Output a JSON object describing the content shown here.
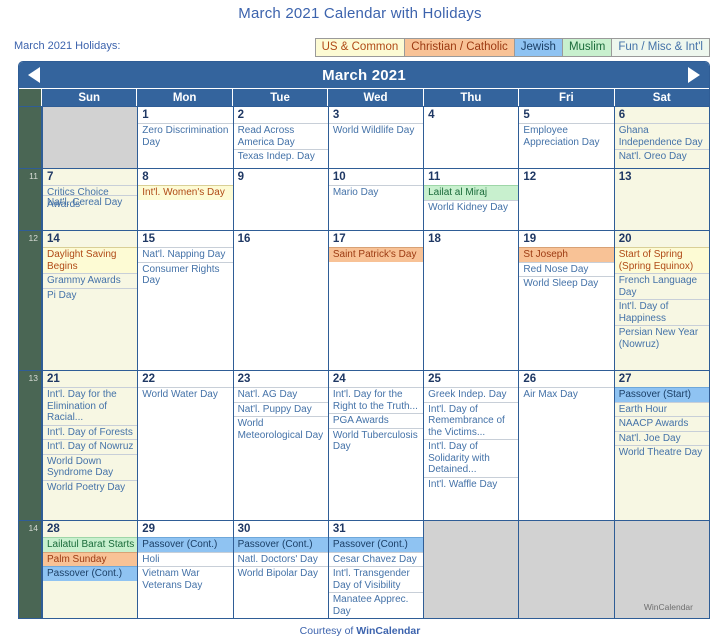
{
  "title": "March 2021 Calendar with Holidays",
  "legend": {
    "label": "March 2021 Holidays:",
    "chips": [
      {
        "label": "US & Common",
        "bg": "#fdfbd4",
        "fg": "#b04a16"
      },
      {
        "label": "Christian / Catholic",
        "bg": "#f8c296",
        "fg": "#9c3a12"
      },
      {
        "label": "Jewish",
        "bg": "#8fc3f2",
        "fg": "#1b3f66"
      },
      {
        "label": "Muslim",
        "bg": "#c8f0ce",
        "fg": "#1a6b3a"
      },
      {
        "label": "Fun / Misc & Int'l",
        "bg": "#eef7ee",
        "fg": "#4472a8"
      }
    ]
  },
  "nav": {
    "month_title": "March 2021",
    "prev_icon": "left-triangle-icon",
    "next_icon": "right-triangle-icon"
  },
  "weekdays": [
    "Sun",
    "Mon",
    "Tue",
    "Wed",
    "Thu",
    "Fri",
    "Sat"
  ],
  "weeks": [
    {
      "number": "",
      "days": [
        {
          "num": "",
          "blank": true,
          "weekend": false,
          "events": []
        },
        {
          "num": "1",
          "weekend": false,
          "events": [
            {
              "text": "Zero Discrimination Day",
              "cat": "plain"
            }
          ]
        },
        {
          "num": "2",
          "weekend": false,
          "events": [
            {
              "text": "Read Across America Day",
              "cat": "plain"
            },
            {
              "text": "Texas Indep. Day",
              "cat": "plain"
            }
          ]
        },
        {
          "num": "3",
          "weekend": false,
          "events": [
            {
              "text": "World Wildlife Day",
              "cat": "plain"
            }
          ]
        },
        {
          "num": "4",
          "weekend": false,
          "events": []
        },
        {
          "num": "5",
          "weekend": false,
          "events": [
            {
              "text": "Employee Appreciation Day",
              "cat": "plain"
            }
          ]
        },
        {
          "num": "6",
          "weekend": true,
          "events": [
            {
              "text": "Ghana Independence Day",
              "cat": "plain"
            },
            {
              "text": "Nat'l. Oreo Day",
              "cat": "plain"
            }
          ]
        }
      ]
    },
    {
      "number": "11",
      "days": [
        {
          "num": "7",
          "weekend": true,
          "events": [
            {
              "text": "Critics Choice Awards",
              "cat": "plain",
              "overlap_with": "Nat'l. Cereal Day"
            }
          ]
        },
        {
          "num": "8",
          "weekend": false,
          "events": [
            {
              "text": "Int'l. Women's Day",
              "cat": "us"
            }
          ]
        },
        {
          "num": "9",
          "weekend": false,
          "events": []
        },
        {
          "num": "10",
          "weekend": false,
          "events": [
            {
              "text": "Mario Day",
              "cat": "plain"
            }
          ]
        },
        {
          "num": "11",
          "weekend": false,
          "events": [
            {
              "text": "Lailat al Miraj",
              "cat": "muslim"
            },
            {
              "text": "World Kidney Day",
              "cat": "plain"
            }
          ]
        },
        {
          "num": "12",
          "weekend": false,
          "events": []
        },
        {
          "num": "13",
          "weekend": true,
          "events": []
        }
      ]
    },
    {
      "number": "12",
      "days": [
        {
          "num": "14",
          "weekend": true,
          "events": [
            {
              "text": "Daylight Saving Begins",
              "cat": "us"
            },
            {
              "text": "Grammy Awards",
              "cat": "plain"
            },
            {
              "text": "Pi Day",
              "cat": "plain"
            }
          ]
        },
        {
          "num": "15",
          "weekend": false,
          "events": [
            {
              "text": "Nat'l. Napping Day",
              "cat": "plain"
            },
            {
              "text": "Consumer Rights Day",
              "cat": "plain"
            }
          ]
        },
        {
          "num": "16",
          "weekend": false,
          "events": []
        },
        {
          "num": "17",
          "weekend": false,
          "events": [
            {
              "text": "Saint Patrick's Day",
              "cat": "christ"
            }
          ]
        },
        {
          "num": "18",
          "weekend": false,
          "events": []
        },
        {
          "num": "19",
          "weekend": false,
          "events": [
            {
              "text": "St Joseph",
              "cat": "christ"
            },
            {
              "text": "Red Nose Day",
              "cat": "plain"
            },
            {
              "text": "World Sleep Day",
              "cat": "plain"
            }
          ]
        },
        {
          "num": "20",
          "weekend": true,
          "events": [
            {
              "text": "Start of Spring (Spring Equinox)",
              "cat": "us"
            },
            {
              "text": "French Language Day",
              "cat": "plain"
            },
            {
              "text": "Int'l. Day of Happiness",
              "cat": "plain"
            },
            {
              "text": "Persian New Year (Nowruz)",
              "cat": "plain"
            }
          ]
        }
      ]
    },
    {
      "number": "13",
      "days": [
        {
          "num": "21",
          "weekend": true,
          "events": [
            {
              "text": "Int'l. Day for the Elimination of Racial...",
              "cat": "plain"
            },
            {
              "text": "Int'l. Day of Forests",
              "cat": "plain"
            },
            {
              "text": "Int'l. Day of Nowruz",
              "cat": "plain"
            },
            {
              "text": "World Down Syndrome Day",
              "cat": "plain"
            },
            {
              "text": "World Poetry Day",
              "cat": "plain"
            }
          ]
        },
        {
          "num": "22",
          "weekend": false,
          "events": [
            {
              "text": "World Water Day",
              "cat": "plain"
            }
          ]
        },
        {
          "num": "23",
          "weekend": false,
          "events": [
            {
              "text": "Nat'l. AG Day",
              "cat": "plain"
            },
            {
              "text": "Nat'l. Puppy Day",
              "cat": "plain"
            },
            {
              "text": "World Meteorological Day",
              "cat": "plain"
            }
          ]
        },
        {
          "num": "24",
          "weekend": false,
          "events": [
            {
              "text": "Int'l. Day for the Right to the Truth...",
              "cat": "plain"
            },
            {
              "text": "PGA Awards",
              "cat": "plain"
            },
            {
              "text": "World Tuberculosis Day",
              "cat": "plain"
            }
          ]
        },
        {
          "num": "25",
          "weekend": false,
          "events": [
            {
              "text": "Greek Indep. Day",
              "cat": "plain"
            },
            {
              "text": "Int'l. Day of Remembrance of the Victims...",
              "cat": "plain"
            },
            {
              "text": "Int'l. Day of Solidarity with Detained...",
              "cat": "plain"
            },
            {
              "text": "Int'l. Waffle Day",
              "cat": "plain"
            }
          ]
        },
        {
          "num": "26",
          "weekend": false,
          "events": [
            {
              "text": "Air Max Day",
              "cat": "plain"
            }
          ]
        },
        {
          "num": "27",
          "weekend": true,
          "events": [
            {
              "text": "Passover (Start)",
              "cat": "jewish"
            },
            {
              "text": "Earth Hour",
              "cat": "plain"
            },
            {
              "text": "NAACP Awards",
              "cat": "plain"
            },
            {
              "text": "Nat'l. Joe Day",
              "cat": "plain"
            },
            {
              "text": "World Theatre Day",
              "cat": "plain"
            }
          ]
        }
      ]
    },
    {
      "number": "14",
      "days": [
        {
          "num": "28",
          "weekend": true,
          "events": [
            {
              "text": "Lailatul Barat Starts",
              "cat": "muslim"
            },
            {
              "text": "Palm Sunday",
              "cat": "christ"
            },
            {
              "text": "Passover (Cont.)",
              "cat": "jewish"
            }
          ]
        },
        {
          "num": "29",
          "weekend": false,
          "events": [
            {
              "text": "Passover (Cont.)",
              "cat": "jewish"
            },
            {
              "text": "Holi",
              "cat": "plain"
            },
            {
              "text": "Vietnam War Veterans Day",
              "cat": "plain"
            }
          ]
        },
        {
          "num": "30",
          "weekend": false,
          "events": [
            {
              "text": "Passover (Cont.)",
              "cat": "jewish"
            },
            {
              "text": "Natl. Doctors' Day",
              "cat": "plain"
            },
            {
              "text": "World Bipolar Day",
              "cat": "plain"
            }
          ]
        },
        {
          "num": "31",
          "weekend": false,
          "events": [
            {
              "text": "Passover (Cont.)",
              "cat": "jewish"
            },
            {
              "text": "Cesar Chavez Day",
              "cat": "plain"
            },
            {
              "text": "Int'l. Transgender Day of Visibility",
              "cat": "plain"
            },
            {
              "text": "Manatee Apprec. Day",
              "cat": "plain"
            }
          ]
        },
        {
          "num": "",
          "blank": true,
          "weekend": false,
          "events": []
        },
        {
          "num": "",
          "blank": true,
          "weekend": false,
          "events": []
        },
        {
          "num": "",
          "blank": true,
          "weekend": false,
          "events": []
        }
      ]
    }
  ],
  "watermark": "WinCalendar",
  "footer": {
    "prefix": "Courtesy of ",
    "brand": "WinCalendar"
  }
}
